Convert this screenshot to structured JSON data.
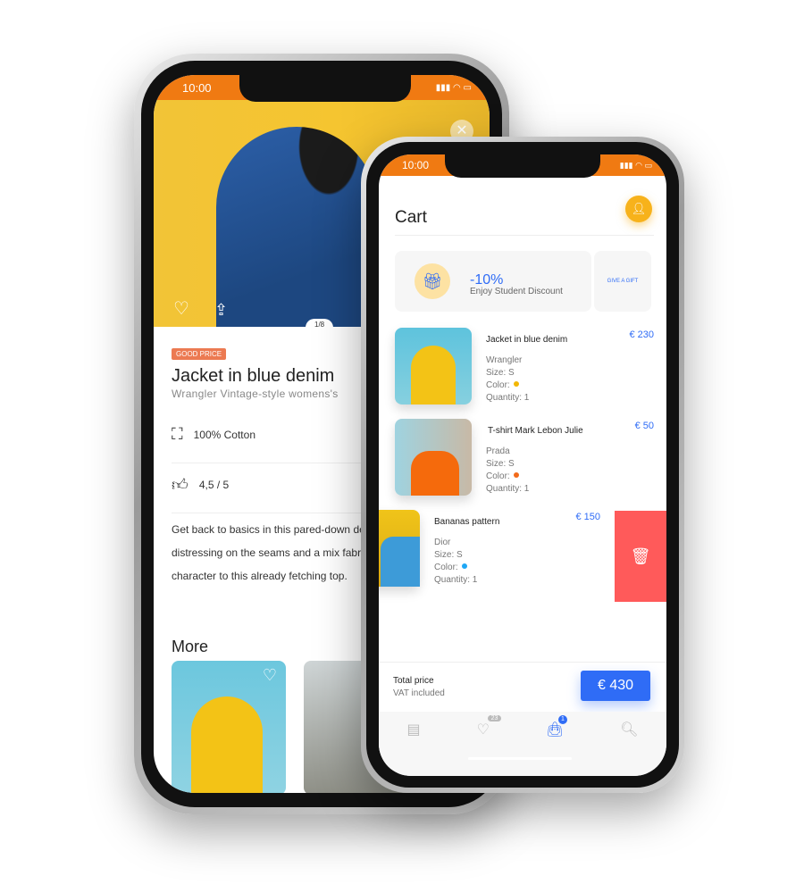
{
  "product_screen": {
    "status_time": "10:00",
    "image_counter": "1/8",
    "badge": "GOOD PRICE",
    "title": "Jacket in blue denim",
    "subtitle": "Wrangler Vintage-style womens's",
    "material": "100% Cotton",
    "rating": "4,5 / 5",
    "description": [
      "Get back to basics in this pared-down de",
      "distressing on the seams and a mix fabric",
      "character to this already fetching top."
    ],
    "more_heading": "More"
  },
  "cart_screen": {
    "status_time": "10:00",
    "title": "Cart",
    "promo": {
      "discount": "-10%",
      "text": "Enjoy Student Discount",
      "gift_label": "GIVE A GIFT"
    },
    "items": [
      {
        "name": "Jacket in blue denim",
        "brand": "Wrangler",
        "size": "Size: S",
        "color_label": "Color:",
        "color": "#f2b705",
        "quantity": "Quantity: 1",
        "price": "€ 230"
      },
      {
        "name": "T-shirt Mark Lebon Julie",
        "brand": "Prada",
        "size": "Size: S",
        "color_label": "Color:",
        "color": "#f26a1b",
        "quantity": "Quantity: 1",
        "price": "€ 50"
      },
      {
        "name": "Bananas pattern",
        "brand": "Dior",
        "size": "Size: S",
        "color_label": "Color:",
        "color": "#1ea7f5",
        "quantity": "Quantity: 1",
        "price": "€ 150"
      }
    ],
    "total_label": "Total price",
    "vat_label": "VAT included",
    "total_button": "€ 430",
    "nav": {
      "favorites_badge": "23",
      "bag_badge": "1"
    },
    "accent": "#2f6cf6",
    "delete_color": "#ff5a5a"
  }
}
